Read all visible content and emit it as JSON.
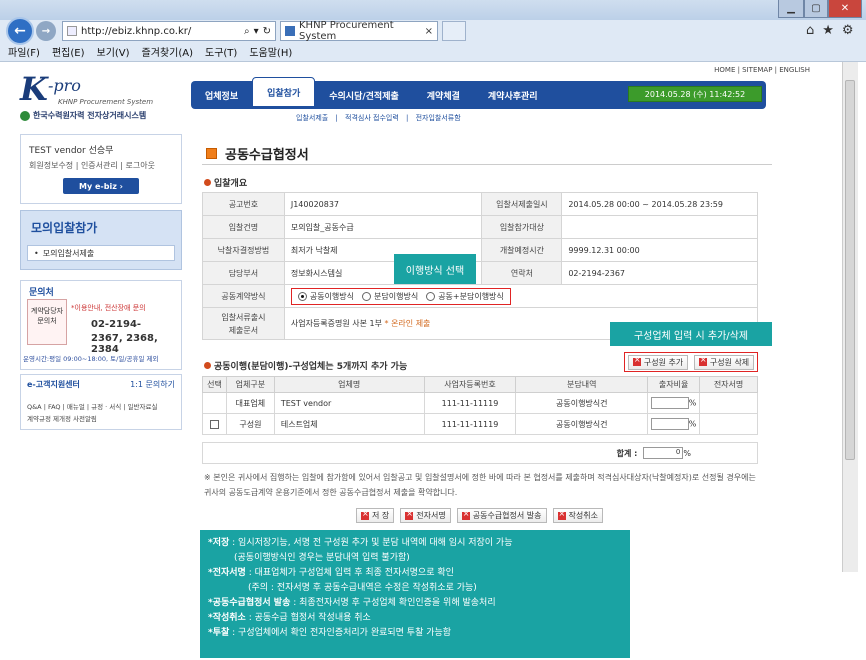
{
  "browser": {
    "url": "http://ebiz.khnp.co.kr/",
    "url_domain_bold": "khnp",
    "tab_title": "KHNP Procurement System",
    "search_icon": "search-icon",
    "menu": [
      "파일(F)",
      "편집(E)",
      "보기(V)",
      "즐겨찾기(A)",
      "도구(T)",
      "도움말(H)"
    ]
  },
  "site": {
    "logo_k": "K",
    "logo_pro": "-pro",
    "logo_sub": "KHNP Procurement System",
    "logo_kr": "한국수력원자력 전자상거래시스템",
    "top_links": "HOME  |  SITEMAP  |  ENGLISH",
    "nav": [
      "업체정보",
      "입찰참가",
      "수의시담/견적제출",
      "계약체결",
      "계약사후관리"
    ],
    "nav_active": "입찰참가",
    "datetime": "2014.05.28 (수)  11:42:52",
    "subnav": [
      "입찰서제출",
      "|",
      "적격심사 접수입력",
      "|",
      "전자입찰서류함"
    ]
  },
  "sidebar": {
    "user": "TEST vendor  선승무",
    "links": "회원정보수정  |  인증서관리  |  로그아웃",
    "my_ebiz": "My e-biz  ›",
    "mock_title": "모의입찰참가",
    "mock_item": "모의입찰서제출",
    "inquiry_title": "문의처",
    "inquiry_contact": "계약담당자 문의처",
    "inquiry_guide": "*이용안내, 전산장애 문의",
    "phone_line1": "02-2194-",
    "phone_line2": "2367, 2368, 2384",
    "hours": "운영시간:평일 09:00~18:00, 토/일/공휴일 제외",
    "cc_title": "e-고객지원센터",
    "cc_link": "1:1 문의하기",
    "cc_line1": "Q&A | FAQ | 매뉴얼 | 규정 · 서식 | 일반자료실",
    "cc_line2": "계약규정 제개정 사전알림"
  },
  "main": {
    "title": "공동수급협정서",
    "sec1": "입찰개요",
    "rows": [
      {
        "l1": "공고번호",
        "v1": "J140020837",
        "l2": "입찰서제출일시",
        "v2": "2014.05.28 00:00 ~ 2014.05.28 23:59"
      },
      {
        "l1": "입찰건명",
        "v1": "모의입찰_공동수급",
        "l2": "입찰참가대상",
        "v2": ""
      },
      {
        "l1": "낙찰자결정방법",
        "v1": "최저가 낙찰제",
        "l2": "개찰예정시간",
        "v2": "9999.12.31 00:00"
      },
      {
        "l1": "담당부서",
        "v1": "정보화시스템실",
        "l2": "연락처",
        "v2": "02-2194-2367"
      }
    ],
    "joint_label": "공동계약방식",
    "joint_opts": [
      "공동이행방식",
      "분담이행방식",
      "공동+분담이행방식"
    ],
    "docs_label1": "입찰서류출시",
    "docs_label2": "제출문서",
    "docs_value": "사업자등록증명원 사본 1부",
    "docs_note": "* 온라인 제출",
    "sec2": "공동이행(분담이행)-구성업체는 5개까지 추가 가능",
    "add_btn": "구성원 추가",
    "del_btn": "구성원 삭제",
    "cols": [
      "선택",
      "업체구분",
      "업체명",
      "사업자등록번호",
      "분담내역",
      "출자비율",
      "전자서명"
    ],
    "members": [
      {
        "type": "대표업체",
        "name": "TEST vendor",
        "biz": "111-11-11119",
        "share": "공동이행방식건",
        "pct": "%"
      },
      {
        "type": "구성원",
        "name": "테스트업체",
        "biz": "111-11-11119",
        "share": "공동이행방식건",
        "pct": "%"
      }
    ],
    "total_label": "합계 :",
    "total_value": "0",
    "total_unit": "%",
    "notice": "※ 본인은 귀사에서 집행하는 입찰에 참가함에 있어서 입찰공고 및 입찰설명서에 정한 바에 따라 본 협정서를 제출하며 적격심사대상자(낙찰예정자)로 선정될 경우에는 귀사의 공동도급계약 운용기준에서 정한 공동수급협정서 제출을 확약합니다.",
    "btns": [
      "저 장",
      "전자서명",
      "공동수급협정서 발송",
      "작성취소"
    ]
  },
  "callouts": {
    "method": "이행방식 선택",
    "member": "구성업체 입력 시 추가/삭제"
  },
  "notes": [
    {
      "b": "*저장",
      "t": " : 임시저장기능, 서명 전 구성원 추가 및 분담 내역에 대해 임시 저장이 가능"
    },
    {
      "b": "",
      "t": "(공동이행방식인 경우는 분담내역 입력 불가함)"
    },
    {
      "b": "*전자서명",
      "t": " : 대표업체가 구성업체 입력 후 최종 전자서명으로 확인"
    },
    {
      "b": "",
      "t": "(주의 : 전자서명 후 공동수급내역은 수정은 작성취소로 가능)"
    },
    {
      "b": "*공동수급협정서 발송",
      "t": " : 최종전자서명 후  구성업체 확인인증을 위해 발송처리"
    },
    {
      "b": "*작성취소",
      "t": " : 공동수급 협정서 작성내용 취소"
    },
    {
      "b": "*투찰",
      "t": " : 구성업체에서 확인 전자인증처리가 완료되면 투찰 가능함"
    }
  ]
}
